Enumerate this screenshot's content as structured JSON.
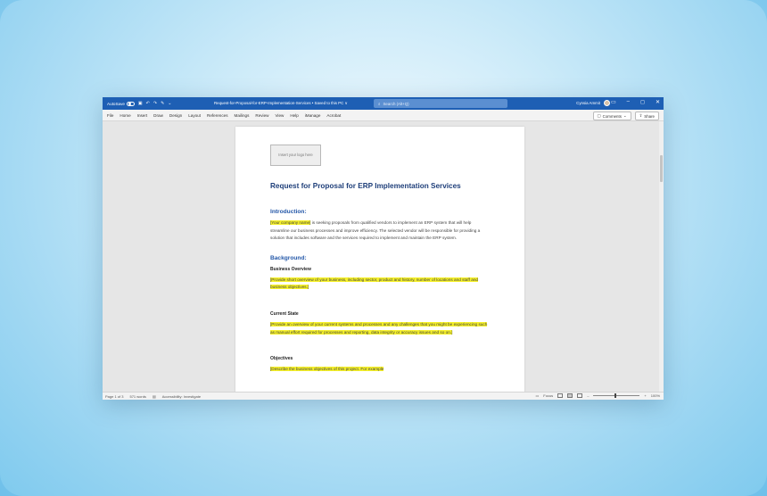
{
  "titlebar": {
    "autosave_label": "AutoSave",
    "autosave_state": "Off",
    "document_title": "Request-for-Proposal-for-ERP-Implementation-Services • Saved to this PC ∨",
    "search_placeholder": "Search (Alt+Q)",
    "user_name": "Cynsia Ammit"
  },
  "menu": {
    "items": [
      "File",
      "Home",
      "Insert",
      "Draw",
      "Design",
      "Layout",
      "References",
      "Mailings",
      "Review",
      "View",
      "Help",
      "iManage",
      "Acrobat"
    ],
    "comments_label": "Comments",
    "share_label": "Share"
  },
  "document": {
    "logo_placeholder": "Insert your logo here",
    "title": "Request for Proposal for ERP Implementation Services",
    "intro_heading": "Introduction:",
    "intro_highlight": "[Your company name]",
    "intro_text": " is seeking proposals from qualified vendors to implement an ERP system that will help streamline our business processes and improve efficiency. The selected vendor will be responsible for providing a solution that includes software and the services required to implement and maintain the ERP system.",
    "background_heading": "Background:",
    "business_overview_heading": "Business Overview",
    "business_overview_text": "[Provide short overview of your business, including sector, product and history, number of locations and staff and business objectives.]",
    "current_state_heading": "Current State",
    "current_state_text": "[Provide an overview of your current systems and processes and any challenges that you might be experiencing such as manual effort required for processes and reporting, data integrity or accuracy issues and so on.]",
    "objectives_heading": "Objectives",
    "objectives_text": "[Describe the business objectives of this project. For example"
  },
  "status": {
    "page": "Page 1 of 3",
    "words": "571 words",
    "accessibility": "Accessibility: Investigate",
    "focus": "Focus",
    "zoom": "100%"
  }
}
